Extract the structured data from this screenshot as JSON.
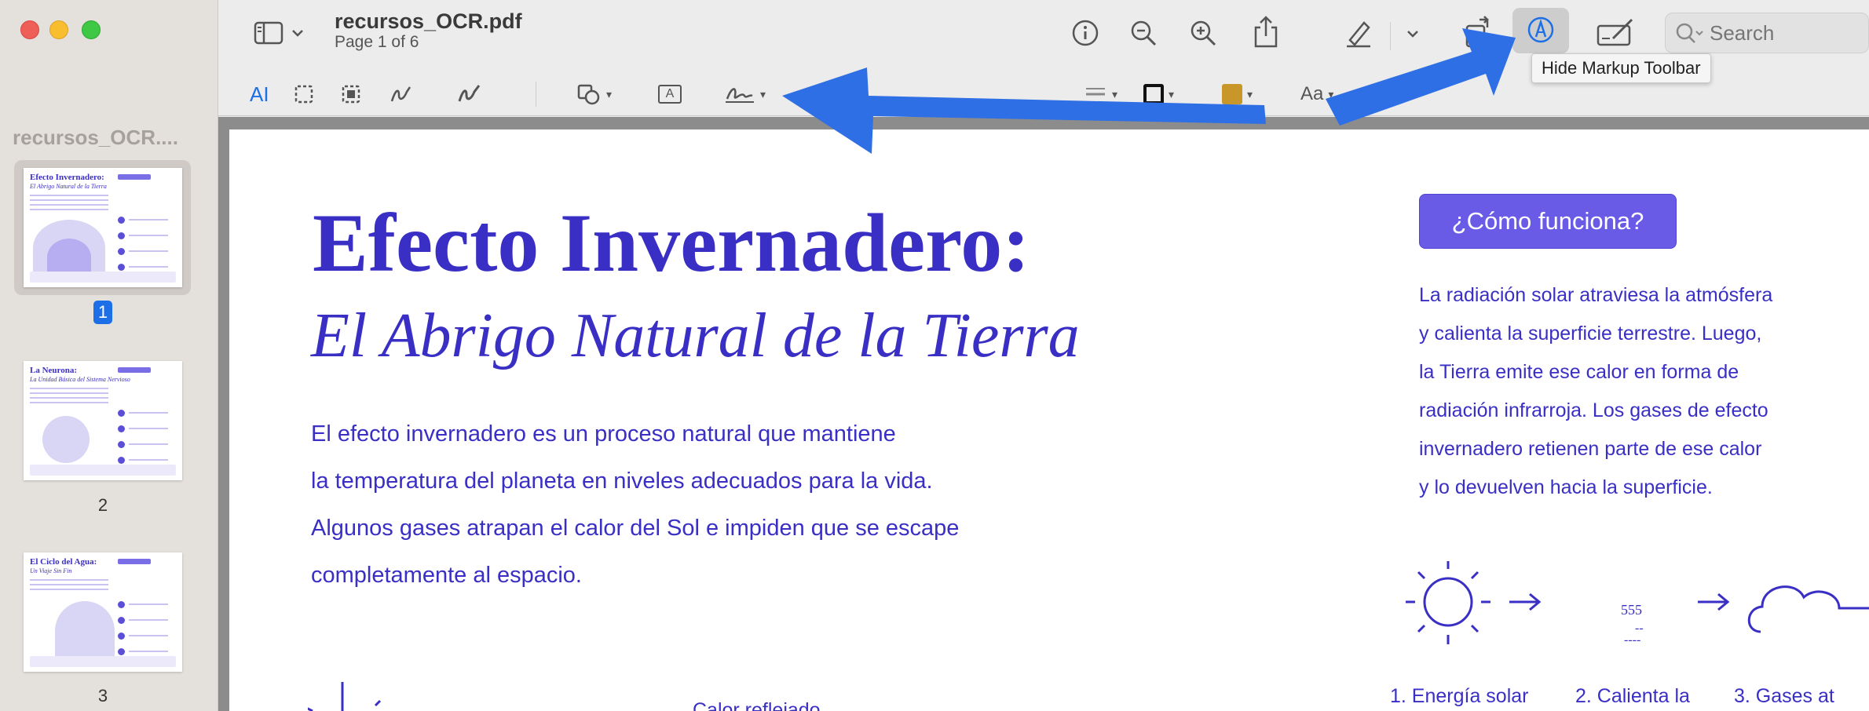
{
  "window": {
    "doc_title": "recursos_OCR.pdf",
    "page_indicator": "Page 1 of 6"
  },
  "sidebar": {
    "title": "recursos_OCR....",
    "thumbnails": [
      {
        "page": "1",
        "title": "Efecto Invernadero:",
        "subtitle": "El Abrigo Natural de la Tierra",
        "selected": true
      },
      {
        "page": "2",
        "title": "La Neurona:",
        "subtitle": "La Unidad Básica del Sistema Nervioso",
        "selected": false
      },
      {
        "page": "3",
        "title": "El Ciclo del Agua:",
        "subtitle": "Un Viaje Sin Fin",
        "selected": false
      }
    ]
  },
  "toolbar": {
    "sidebar_icon": "sidebar-icon",
    "info_icon": "info-icon",
    "zoom_out_icon": "zoom-out-icon",
    "zoom_in_icon": "zoom-in-icon",
    "share_icon": "share-icon",
    "highlight_icon": "highlighter-icon",
    "rotate_icon": "rotate-icon",
    "markup_icon": "markup-pen-icon",
    "form_icon": "form-fill-icon",
    "search_placeholder": "Search",
    "tooltip": "Hide Markup Toolbar"
  },
  "markup": {
    "text_select": "AI",
    "text_box": "A",
    "font": "Aa",
    "accent_color": "#3a2fc4",
    "fill_color": "#c9962a"
  },
  "page": {
    "title": "Efecto Invernadero:",
    "subtitle": "El Abrigo Natural de la Tierra",
    "paragraph": [
      "El efecto invernadero es un proceso natural que mantiene",
      "la temperatura del planeta en niveles adecuados para la vida.",
      "Algunos gases atrapan el calor del Sol e impiden que se escape",
      "completamente al espacio."
    ],
    "how_button": "¿Cómo funciona?",
    "how_paragraph": [
      "La radiación solar atraviesa la atmósfera",
      "y calienta la superficie terrestre. Luego,",
      "la Tierra emite ese calor en forma de",
      "radiación infrarroja. Los gases de efecto",
      "invernadero retienen parte de ese calor",
      "y lo devuelven hacia la superficie."
    ],
    "diagram_num": "555",
    "diagram_dash1": "--",
    "diagram_dash2": "----",
    "steps": [
      "1. Energía solar",
      "2. Calienta la",
      "3. Gases at"
    ],
    "bottom_text": "Calor reflejado"
  },
  "colors": {
    "accent": "#3a2fc4",
    "button": "#6a5be6",
    "annotation_arrow": "#2f6fe6",
    "selection": "#1d6fe8"
  }
}
